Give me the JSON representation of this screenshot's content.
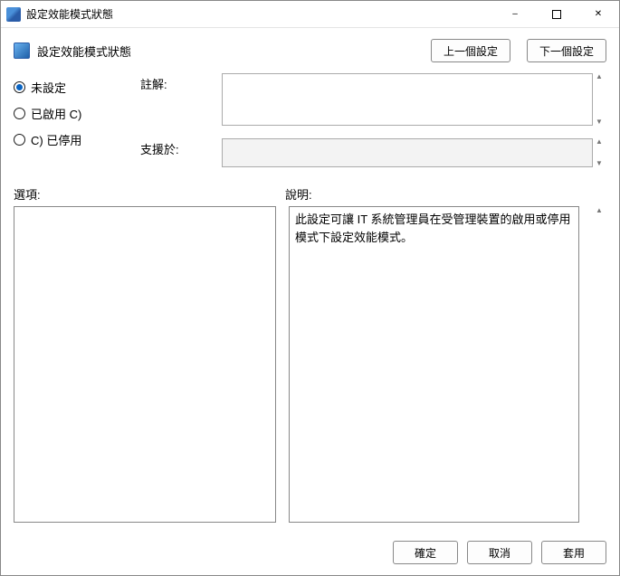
{
  "window": {
    "title": "設定效能模式狀態"
  },
  "header": {
    "title": "設定效能模式狀態",
    "prev_setting": "上一個設定",
    "next_setting": "下一個設定"
  },
  "radios": {
    "not_configured": "未設定",
    "enabled": "已啟用 C)",
    "disabled": "C) 已停用",
    "selected": "not_configured"
  },
  "fields": {
    "comment_label": "註解:",
    "comment_value": "",
    "supported_label": "支援於:",
    "supported_value": ""
  },
  "sections": {
    "options_label": "選項:",
    "help_label": "說明:"
  },
  "help_text": "此設定可讓 IT 系統管理員在受管理裝置的啟用或停用模式下設定效能模式。",
  "footer": {
    "ok": "確定",
    "cancel": "取消",
    "apply": "套用"
  }
}
